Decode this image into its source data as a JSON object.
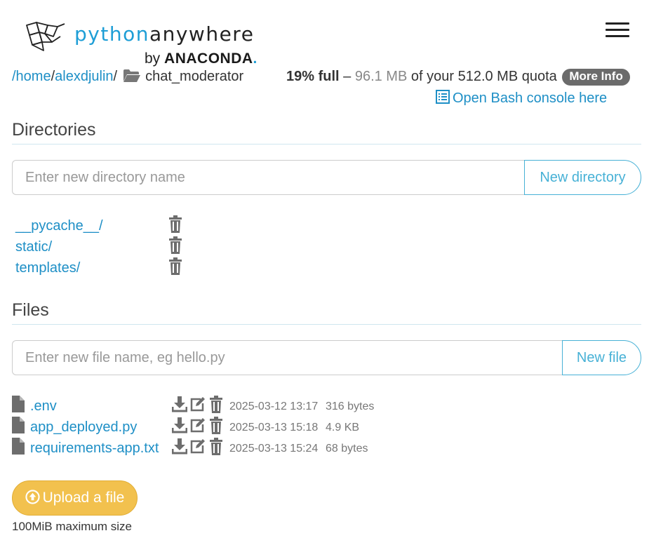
{
  "header": {
    "logo_python": "python",
    "logo_anywhere": "anywhere",
    "logo_by": "by",
    "logo_anaconda": "ANACONDA",
    "logo_dot": ".",
    "menu_icon": "hamburger-menu-icon"
  },
  "breadcrumb": {
    "root": "/home",
    "sep1": "/",
    "user": "alexdjulin",
    "sep2": "/",
    "folder_icon": "folder-open-icon",
    "current": "chat_moderator"
  },
  "quota": {
    "percent": "19% full",
    "dash": " – ",
    "used": "96.1 MB",
    "of_text": " of your 512.0 MB quota",
    "more_info": "More Info"
  },
  "bash_link": "Open Bash console here",
  "directories": {
    "title": "Directories",
    "placeholder": "Enter new directory name",
    "button": "New directory",
    "items": [
      {
        "name": "__pycache__/"
      },
      {
        "name": "static/"
      },
      {
        "name": "templates/"
      }
    ]
  },
  "files": {
    "title": "Files",
    "placeholder": "Enter new file name, eg hello.py",
    "button": "New file",
    "items": [
      {
        "name": ".env",
        "date": "2025-03-12 13:17",
        "size": "316 bytes"
      },
      {
        "name": "app_deployed.py",
        "date": "2025-03-13 15:18",
        "size": "4.9 KB"
      },
      {
        "name": "requirements-app.txt",
        "date": "2025-03-13 15:24",
        "size": "68 bytes"
      }
    ]
  },
  "upload": {
    "button": "Upload a file",
    "note": "100MiB maximum size"
  },
  "colors": {
    "link": "#1e8fc6",
    "brand_blue": "#1e9ed6",
    "button_outline": "#47b1d6",
    "upload": "#f2c14e"
  }
}
